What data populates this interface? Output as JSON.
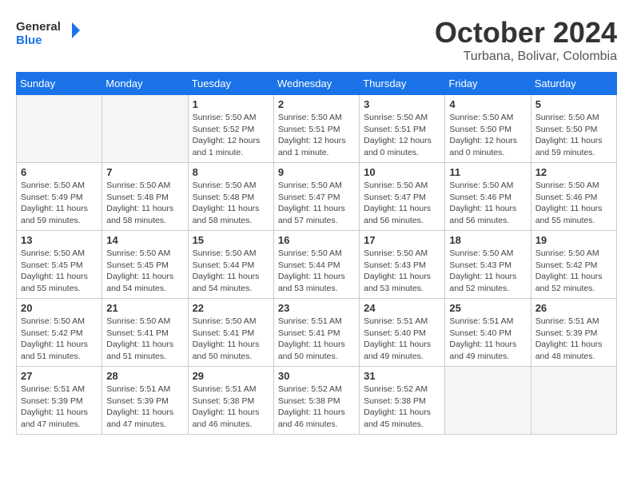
{
  "logo": {
    "name": "General",
    "name2": "Blue"
  },
  "title": "October 2024",
  "location": "Turbana, Bolivar, Colombia",
  "days_of_week": [
    "Sunday",
    "Monday",
    "Tuesday",
    "Wednesday",
    "Thursday",
    "Friday",
    "Saturday"
  ],
  "weeks": [
    [
      {
        "day": "",
        "sunrise": "",
        "sunset": "",
        "daylight": ""
      },
      {
        "day": "",
        "sunrise": "",
        "sunset": "",
        "daylight": ""
      },
      {
        "day": "1",
        "sunrise": "Sunrise: 5:50 AM",
        "sunset": "Sunset: 5:52 PM",
        "daylight": "Daylight: 12 hours and 1 minute."
      },
      {
        "day": "2",
        "sunrise": "Sunrise: 5:50 AM",
        "sunset": "Sunset: 5:51 PM",
        "daylight": "Daylight: 12 hours and 1 minute."
      },
      {
        "day": "3",
        "sunrise": "Sunrise: 5:50 AM",
        "sunset": "Sunset: 5:51 PM",
        "daylight": "Daylight: 12 hours and 0 minutes."
      },
      {
        "day": "4",
        "sunrise": "Sunrise: 5:50 AM",
        "sunset": "Sunset: 5:50 PM",
        "daylight": "Daylight: 12 hours and 0 minutes."
      },
      {
        "day": "5",
        "sunrise": "Sunrise: 5:50 AM",
        "sunset": "Sunset: 5:50 PM",
        "daylight": "Daylight: 11 hours and 59 minutes."
      }
    ],
    [
      {
        "day": "6",
        "sunrise": "Sunrise: 5:50 AM",
        "sunset": "Sunset: 5:49 PM",
        "daylight": "Daylight: 11 hours and 59 minutes."
      },
      {
        "day": "7",
        "sunrise": "Sunrise: 5:50 AM",
        "sunset": "Sunset: 5:48 PM",
        "daylight": "Daylight: 11 hours and 58 minutes."
      },
      {
        "day": "8",
        "sunrise": "Sunrise: 5:50 AM",
        "sunset": "Sunset: 5:48 PM",
        "daylight": "Daylight: 11 hours and 58 minutes."
      },
      {
        "day": "9",
        "sunrise": "Sunrise: 5:50 AM",
        "sunset": "Sunset: 5:47 PM",
        "daylight": "Daylight: 11 hours and 57 minutes."
      },
      {
        "day": "10",
        "sunrise": "Sunrise: 5:50 AM",
        "sunset": "Sunset: 5:47 PM",
        "daylight": "Daylight: 11 hours and 56 minutes."
      },
      {
        "day": "11",
        "sunrise": "Sunrise: 5:50 AM",
        "sunset": "Sunset: 5:46 PM",
        "daylight": "Daylight: 11 hours and 56 minutes."
      },
      {
        "day": "12",
        "sunrise": "Sunrise: 5:50 AM",
        "sunset": "Sunset: 5:46 PM",
        "daylight": "Daylight: 11 hours and 55 minutes."
      }
    ],
    [
      {
        "day": "13",
        "sunrise": "Sunrise: 5:50 AM",
        "sunset": "Sunset: 5:45 PM",
        "daylight": "Daylight: 11 hours and 55 minutes."
      },
      {
        "day": "14",
        "sunrise": "Sunrise: 5:50 AM",
        "sunset": "Sunset: 5:45 PM",
        "daylight": "Daylight: 11 hours and 54 minutes."
      },
      {
        "day": "15",
        "sunrise": "Sunrise: 5:50 AM",
        "sunset": "Sunset: 5:44 PM",
        "daylight": "Daylight: 11 hours and 54 minutes."
      },
      {
        "day": "16",
        "sunrise": "Sunrise: 5:50 AM",
        "sunset": "Sunset: 5:44 PM",
        "daylight": "Daylight: 11 hours and 53 minutes."
      },
      {
        "day": "17",
        "sunrise": "Sunrise: 5:50 AM",
        "sunset": "Sunset: 5:43 PM",
        "daylight": "Daylight: 11 hours and 53 minutes."
      },
      {
        "day": "18",
        "sunrise": "Sunrise: 5:50 AM",
        "sunset": "Sunset: 5:43 PM",
        "daylight": "Daylight: 11 hours and 52 minutes."
      },
      {
        "day": "19",
        "sunrise": "Sunrise: 5:50 AM",
        "sunset": "Sunset: 5:42 PM",
        "daylight": "Daylight: 11 hours and 52 minutes."
      }
    ],
    [
      {
        "day": "20",
        "sunrise": "Sunrise: 5:50 AM",
        "sunset": "Sunset: 5:42 PM",
        "daylight": "Daylight: 11 hours and 51 minutes."
      },
      {
        "day": "21",
        "sunrise": "Sunrise: 5:50 AM",
        "sunset": "Sunset: 5:41 PM",
        "daylight": "Daylight: 11 hours and 51 minutes."
      },
      {
        "day": "22",
        "sunrise": "Sunrise: 5:50 AM",
        "sunset": "Sunset: 5:41 PM",
        "daylight": "Daylight: 11 hours and 50 minutes."
      },
      {
        "day": "23",
        "sunrise": "Sunrise: 5:51 AM",
        "sunset": "Sunset: 5:41 PM",
        "daylight": "Daylight: 11 hours and 50 minutes."
      },
      {
        "day": "24",
        "sunrise": "Sunrise: 5:51 AM",
        "sunset": "Sunset: 5:40 PM",
        "daylight": "Daylight: 11 hours and 49 minutes."
      },
      {
        "day": "25",
        "sunrise": "Sunrise: 5:51 AM",
        "sunset": "Sunset: 5:40 PM",
        "daylight": "Daylight: 11 hours and 49 minutes."
      },
      {
        "day": "26",
        "sunrise": "Sunrise: 5:51 AM",
        "sunset": "Sunset: 5:39 PM",
        "daylight": "Daylight: 11 hours and 48 minutes."
      }
    ],
    [
      {
        "day": "27",
        "sunrise": "Sunrise: 5:51 AM",
        "sunset": "Sunset: 5:39 PM",
        "daylight": "Daylight: 11 hours and 47 minutes."
      },
      {
        "day": "28",
        "sunrise": "Sunrise: 5:51 AM",
        "sunset": "Sunset: 5:39 PM",
        "daylight": "Daylight: 11 hours and 47 minutes."
      },
      {
        "day": "29",
        "sunrise": "Sunrise: 5:51 AM",
        "sunset": "Sunset: 5:38 PM",
        "daylight": "Daylight: 11 hours and 46 minutes."
      },
      {
        "day": "30",
        "sunrise": "Sunrise: 5:52 AM",
        "sunset": "Sunset: 5:38 PM",
        "daylight": "Daylight: 11 hours and 46 minutes."
      },
      {
        "day": "31",
        "sunrise": "Sunrise: 5:52 AM",
        "sunset": "Sunset: 5:38 PM",
        "daylight": "Daylight: 11 hours and 45 minutes."
      },
      {
        "day": "",
        "sunrise": "",
        "sunset": "",
        "daylight": ""
      },
      {
        "day": "",
        "sunrise": "",
        "sunset": "",
        "daylight": ""
      }
    ]
  ]
}
